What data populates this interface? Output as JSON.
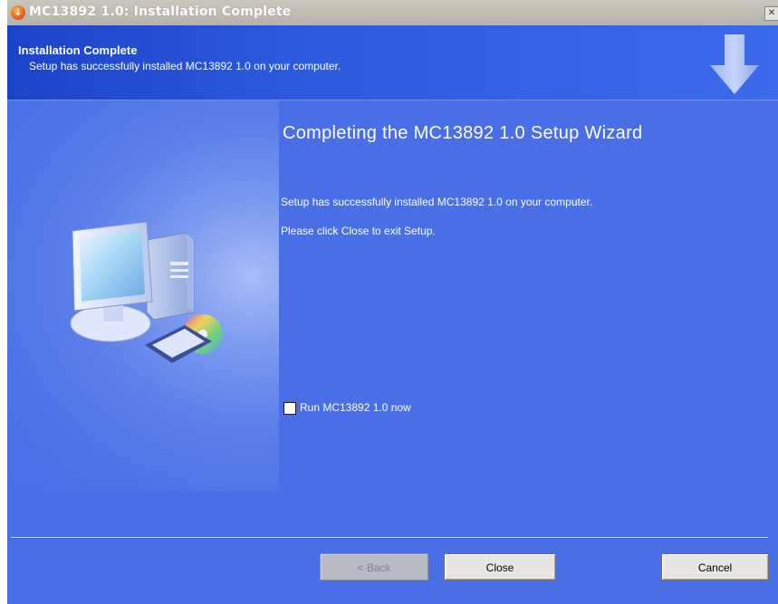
{
  "window": {
    "title": "MC13892 1.0: Installation Complete",
    "close_glyph": "✕"
  },
  "header": {
    "title": "Installation Complete",
    "subtitle": "Setup has successfully installed MC13892 1.0 on your computer."
  },
  "main": {
    "title": "Completing the MC13892 1.0 Setup Wizard",
    "line1": "Setup has successfully installed MC13892 1.0 on your computer.",
    "line2": "Please click Close to exit Setup.",
    "checkbox_label": "Run MC13892 1.0 now",
    "checkbox_checked": false
  },
  "buttons": {
    "back": "< Back",
    "close": "Close",
    "cancel": "Cancel"
  },
  "colors": {
    "page_background": "#4a6ee6",
    "header_background": "#2d5be0",
    "text": "#ffffff"
  },
  "icons": [
    "installer-icon",
    "download-arrow-icon",
    "computer-icon",
    "checkbox-icon",
    "title-close-icon"
  ]
}
